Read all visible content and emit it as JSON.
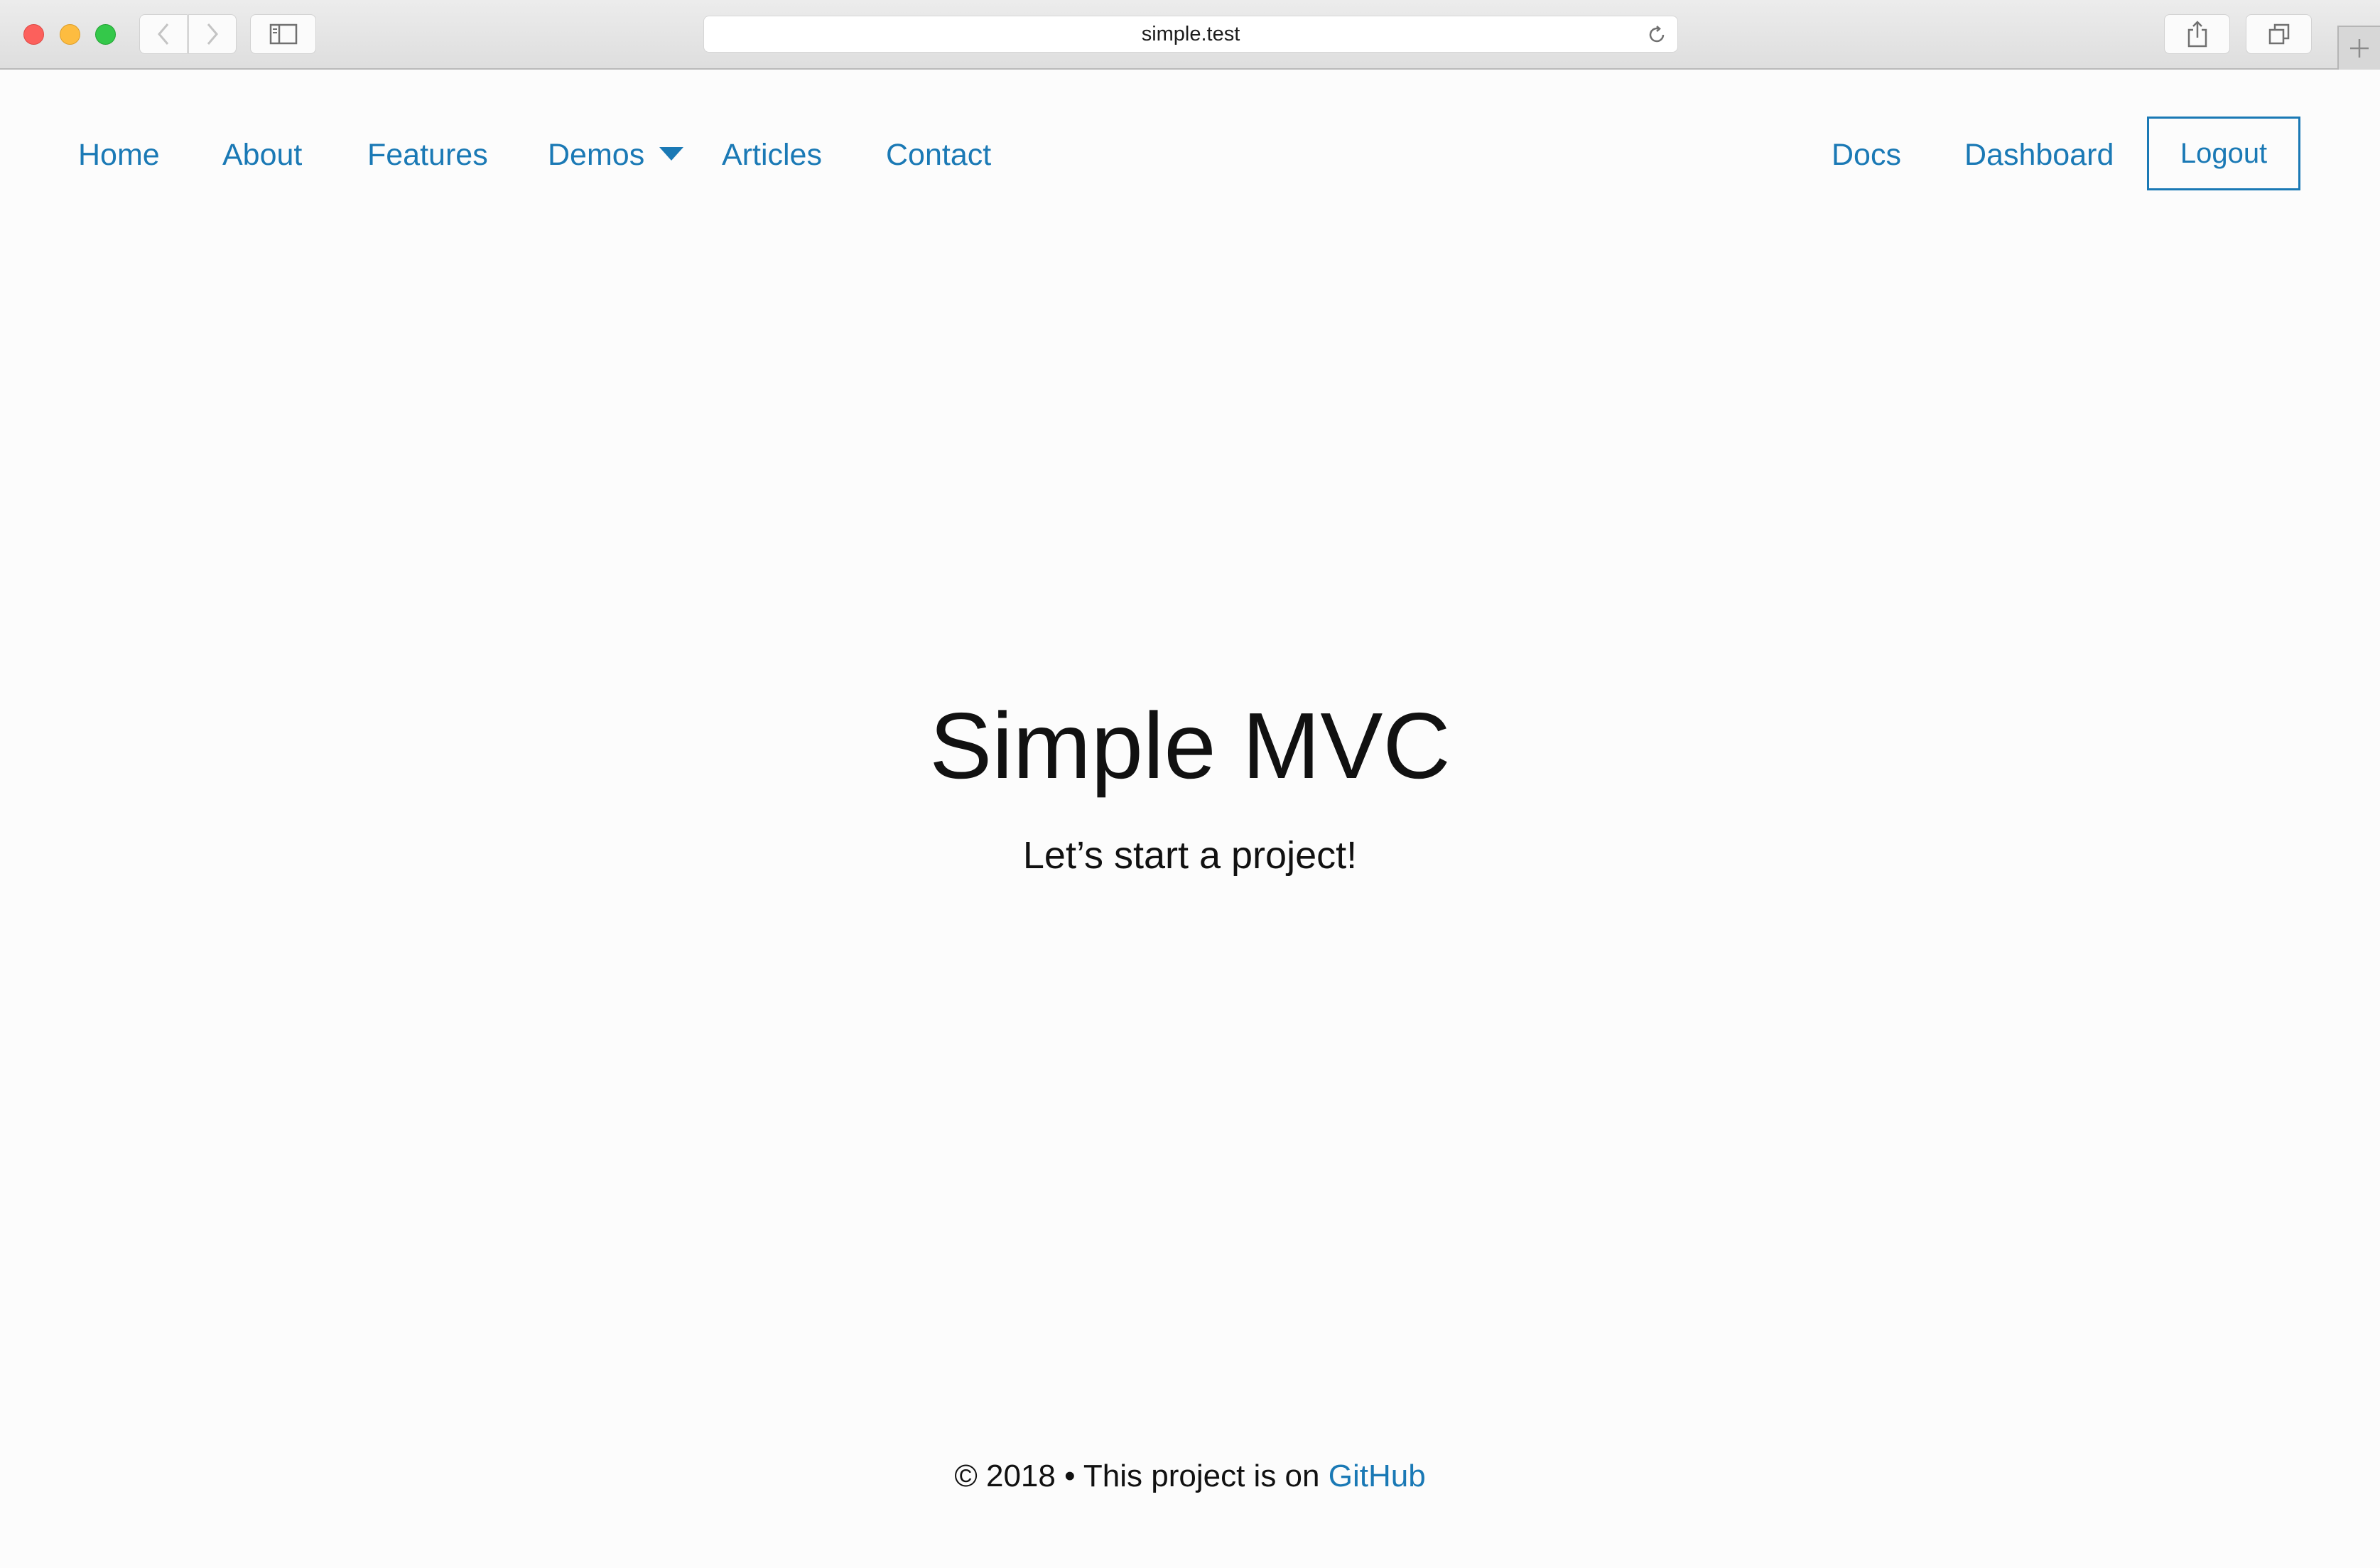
{
  "browser": {
    "url": "simple.test",
    "icons": {
      "back": "chevron-left-icon",
      "forward": "chevron-right-icon",
      "sidebar": "sidebar-icon",
      "reload": "reload-icon",
      "share": "share-icon",
      "tabs": "tabs-icon",
      "new_tab": "plus-icon"
    }
  },
  "nav": {
    "left": [
      {
        "label": "Home"
      },
      {
        "label": "About"
      },
      {
        "label": "Features"
      },
      {
        "label": "Demos"
      },
      {
        "label": "Articles"
      },
      {
        "label": "Contact"
      }
    ],
    "right": [
      {
        "label": "Docs"
      },
      {
        "label": "Dashboard"
      }
    ],
    "logout_label": "Logout",
    "link_color": "#1a79b5"
  },
  "hero": {
    "title": "Simple MVC",
    "subtitle": "Let’s start a project!"
  },
  "footer": {
    "text": "© 2018 • This project is on ",
    "link_label": "GitHub"
  }
}
